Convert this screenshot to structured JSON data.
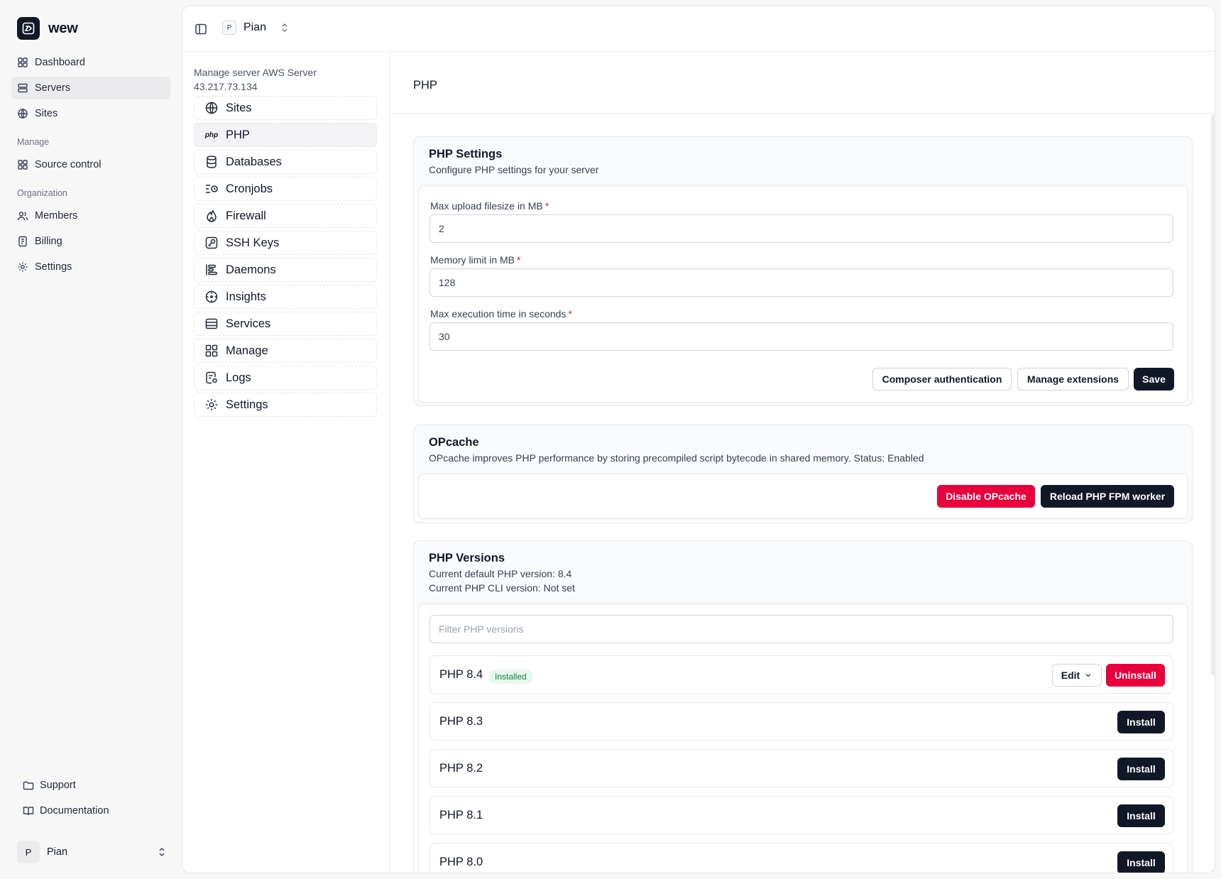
{
  "app": {
    "name": "wew"
  },
  "sidebar": {
    "items": [
      {
        "label": "Dashboard",
        "icon": "grid-icon"
      },
      {
        "label": "Servers",
        "icon": "server-icon",
        "active": true
      },
      {
        "label": "Sites",
        "icon": "globe-icon"
      }
    ],
    "groups": [
      {
        "label": "Manage",
        "items": [
          {
            "label": "Source control",
            "icon": "grid-icon"
          }
        ]
      },
      {
        "label": "Organization",
        "items": [
          {
            "label": "Members",
            "icon": "users-icon"
          },
          {
            "label": "Billing",
            "icon": "receipt-icon"
          },
          {
            "label": "Settings",
            "icon": "gear-icon"
          }
        ]
      }
    ],
    "footer": [
      {
        "label": "Support",
        "icon": "folder-icon"
      },
      {
        "label": "Documentation",
        "icon": "book-icon"
      }
    ],
    "user": {
      "initial": "P",
      "name": "Pian"
    }
  },
  "topbar": {
    "project_initial": "P",
    "project_name": "Pian"
  },
  "server": {
    "title": "Manage server AWS Server",
    "ip": "43.217.73.134"
  },
  "subnav": [
    {
      "label": "Sites",
      "icon": "globe-icon"
    },
    {
      "label": "PHP",
      "icon": "php-icon",
      "icon_text": "php",
      "active": true
    },
    {
      "label": "Databases",
      "icon": "database-icon"
    },
    {
      "label": "Cronjobs",
      "icon": "cron-icon"
    },
    {
      "label": "Firewall",
      "icon": "flame-icon"
    },
    {
      "label": "SSH Keys",
      "icon": "key-icon"
    },
    {
      "label": "Daemons",
      "icon": "daemons-icon"
    },
    {
      "label": "Insights",
      "icon": "insights-icon"
    },
    {
      "label": "Services",
      "icon": "services-icon"
    },
    {
      "label": "Manage",
      "icon": "manage-grid-icon"
    },
    {
      "label": "Logs",
      "icon": "logs-icon"
    },
    {
      "label": "Settings",
      "icon": "gear-icon"
    }
  ],
  "page": {
    "title": "PHP"
  },
  "php_settings": {
    "title": "PHP Settings",
    "description": "Configure PHP settings for your server",
    "fields": [
      {
        "label": "Max upload filesize in MB",
        "value": "2",
        "required": "*"
      },
      {
        "label": "Memory limit in MB",
        "value": "128",
        "required": "*"
      },
      {
        "label": "Max execution time in seconds",
        "value": "30",
        "required": "*"
      }
    ],
    "buttons": {
      "composer": "Composer authentication",
      "extensions": "Manage extensions",
      "save": "Save"
    }
  },
  "opcache": {
    "title": "OPcache",
    "description": "OPcache improves PHP performance by storing precompiled script bytecode in shared memory. Status: Enabled",
    "buttons": {
      "disable": "Disable OPcache",
      "reload": "Reload PHP FPM worker"
    }
  },
  "php_versions": {
    "title": "PHP Versions",
    "default_version": "Current default PHP version: 8.4",
    "cli_version": "Current PHP CLI version: Not set",
    "filter_placeholder": "Filter PHP versions",
    "versions": [
      {
        "name": "PHP 8.4",
        "badge": "Installed",
        "edit_label": "Edit",
        "action": "Uninstall"
      },
      {
        "name": "PHP 8.3",
        "action": "Install"
      },
      {
        "name": "PHP 8.2",
        "action": "Install"
      },
      {
        "name": "PHP 8.1",
        "action": "Install"
      },
      {
        "name": "PHP 8.0",
        "action": "Install"
      }
    ]
  },
  "colors": {
    "primary": "#111827",
    "danger": "#e8003d",
    "success_bg": "#e7f8ee",
    "success_text": "#15803d"
  }
}
